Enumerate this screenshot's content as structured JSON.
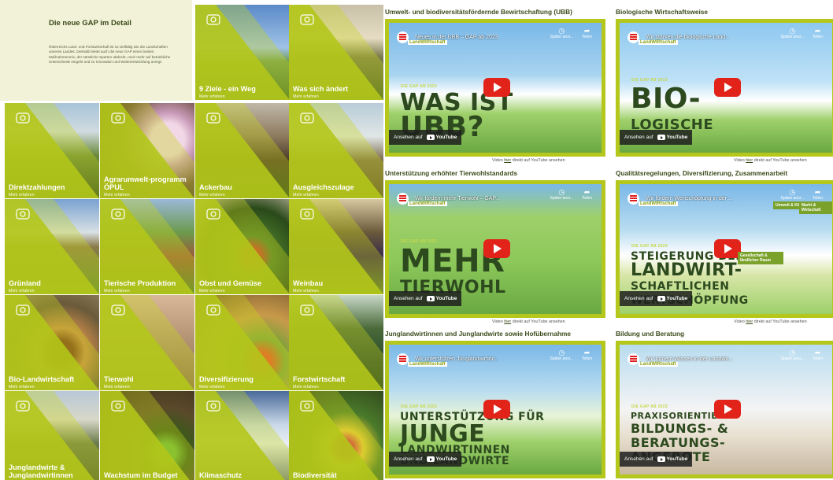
{
  "intro": {
    "title": "Die neue GAP im Detail",
    "text": "Österreichs Land- und Forstwirtschaft ist so vielfältig wie die Landschaften unseres Landes. Deshalb bietet auch die neue GAP einen breiten Maßnahmenmix, der sämtliche Sparten abdeckt, noch mehr auf betriebliche Unterschiede eingeht und zu Innovation und Weiterentwicklung anregt."
  },
  "more_label": "Mehr erfahren",
  "tiles": [
    {
      "label": "9 Ziele - ein Weg",
      "icon": "target-icon"
    },
    {
      "label": "Was sich ändert",
      "icon": "calendar-icon"
    },
    {
      "label": "Direktzahlungen",
      "icon": "coins-icon"
    },
    {
      "label": "Agrarumwelt-programm ÖPUL",
      "icon": "hand-leaf-icon"
    },
    {
      "label": "Ackerbau",
      "icon": "wheat-icon"
    },
    {
      "label": "Ausgleichszulage",
      "icon": "mountain-icon"
    },
    {
      "label": "Grünland",
      "icon": "meadow-icon"
    },
    {
      "label": "Tierische Produktion",
      "icon": "cow-icon"
    },
    {
      "label": "Obst und Gemüse",
      "icon": "fruit-icon"
    },
    {
      "label": "Weinbau",
      "icon": "grapes-icon"
    },
    {
      "label": "Bio-Landwirtschaft",
      "icon": "bio-badge-icon"
    },
    {
      "label": "Tierwohl",
      "icon": "pig-icon"
    },
    {
      "label": "Diversifizierung",
      "icon": "shop-icon"
    },
    {
      "label": "Forstwirtschaft",
      "icon": "trees-icon"
    },
    {
      "label": "Junglandwirte & Junglandwirtinnen",
      "icon": "young-farmers-icon"
    },
    {
      "label": "Wachstum im Budget",
      "icon": "growth-hand-icon"
    },
    {
      "label": "Klimaschutz",
      "icon": "cloud-sun-icon"
    },
    {
      "label": "Biodiversität",
      "icon": "flower-icon"
    }
  ],
  "videos": [
    {
      "section": "Umwelt- und biodiversitätsfördernde Bewirtschaftung (UBB)",
      "title": "Neues in der UBB – GAP ab 2023",
      "big": [
        "WAS IST",
        "UBB?"
      ]
    },
    {
      "section": "Biologische Wirtschaftsweise",
      "title": "Wir stärken die biologische Land...",
      "big": [
        "BIO-",
        "LOGISCHE"
      ]
    },
    {
      "section": "Unterstützung erhöhter Tierwohlstandards",
      "title": "Wir fördern mehr Tierwohl – GAP...",
      "big": [
        "MEHR",
        "TIERWOHL"
      ]
    },
    {
      "section": "Qualitätsregelungen, Diversifizierung, Zusammenarbeit",
      "title": "Wir fördern Wertschöpfung in der ...",
      "big": [
        "STEIGERUNG DER",
        "LANDWIRT-",
        "SCHAFTLICHEN",
        "WERTSCHÖPFUNG"
      ]
    },
    {
      "section": "Junglandwirtinnen und Junglandwirte sowie Hofübernahme",
      "title": "Wir unterstützen Junglandwirtinn...",
      "big": [
        "UNTERSTÜTZUNG FÜR",
        "JUNGE",
        "LANDWIRTINNEN",
        "UND LANDWIRTE"
      ]
    },
    {
      "section": "Bildung und Beratung",
      "title": "Wir fördern Wissen in der Landwir...",
      "big": [
        "PRAXISORIENTIERTE",
        "BILDUNGS- &",
        "BERATUNGS-",
        "ANGEBOTE"
      ]
    }
  ],
  "video_ui": {
    "channel": "LandWIRtschaft",
    "gap_label": "DIE GAP AB 2023",
    "watch_later": "Später ansi...",
    "share": "Teilen",
    "watch_on": "Ansehen auf",
    "youtube": "YouTube",
    "caption_pre": "Video",
    "caption_link": "hier",
    "caption_post": "direkt auf YouTube ansehen",
    "extra_labels": [
      "Umwelt & Klima",
      "Gesellschaft & ländlicher Raum",
      "Markt & Wirtschaft"
    ]
  },
  "colors": {
    "accent": "#b4c71a",
    "dark_green": "#2d4a1f",
    "yt_red": "#e2231a"
  }
}
